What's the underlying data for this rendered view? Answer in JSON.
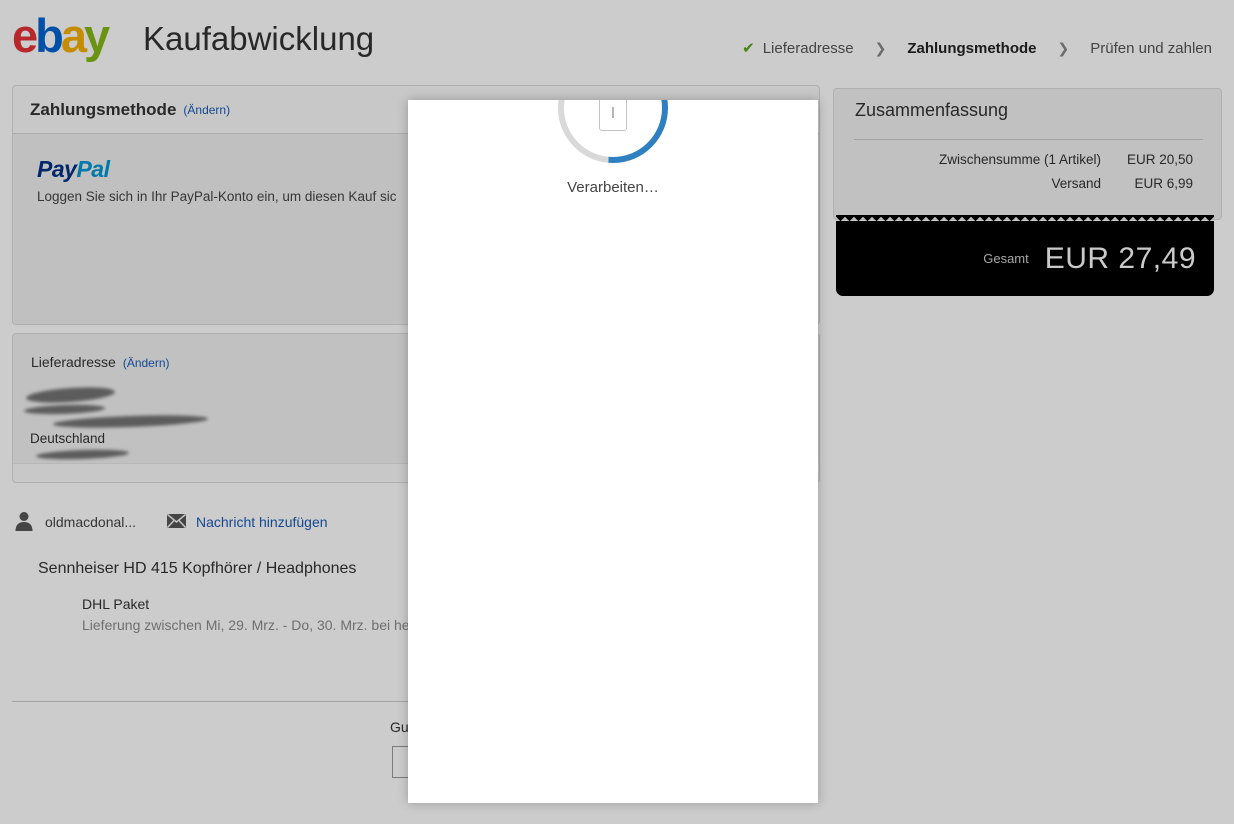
{
  "header": {
    "logo_letters": [
      "e",
      "b",
      "a",
      "y"
    ],
    "title": "Kaufabwicklung"
  },
  "breadcrumb": {
    "steps": [
      {
        "label": "Lieferadresse",
        "state": "completed"
      },
      {
        "label": "Zahlungsmethode",
        "state": "active"
      },
      {
        "label": "Prüfen und zahlen",
        "state": "upcoming"
      }
    ],
    "separator": "❯",
    "check_glyph": "✔"
  },
  "payment": {
    "title": "Zahlungsmethode",
    "change_label": "(Ändern)",
    "provider_logo": {
      "part1": "Pay",
      "part2": "Pal"
    },
    "login_text": "Loggen Sie sich in Ihr PayPal-Konto ein, um diesen Kauf sic"
  },
  "shipping_address": {
    "title": "Lieferadresse",
    "change_label": "(Ändern)",
    "country": "Deutschland",
    "redacted_lines": 4
  },
  "seller": {
    "username": "oldmacdonal...",
    "message_link": "Nachricht hinzufügen"
  },
  "item": {
    "title": "Sennheiser HD 415 Kopfhörer / Headphones",
    "shipping_method": "DHL Paket",
    "delivery_estimate": "Lieferung zwischen Mi, 29. Mrz. - Do, 30. Mrz. bei he"
  },
  "coupon": {
    "label_visible": "Gu",
    "input_value": ""
  },
  "summary": {
    "title": "Zusammenfassung",
    "rows": [
      {
        "label": "Zwischensumme (1 Artikel)",
        "value": "EUR 20,50"
      },
      {
        "label": "Versand",
        "value": "EUR 6,99"
      }
    ],
    "total_label": "Gesamt",
    "total_value": "EUR 27,49"
  },
  "processing_modal": {
    "text": "Verarbeiten…"
  },
  "colors": {
    "ebay_e": "#e53238",
    "ebay_b": "#0064d2",
    "ebay_a": "#f5af02",
    "ebay_y": "#86b817",
    "paypal_dark": "#003087",
    "paypal_light": "#0099d5",
    "link_blue": "#1b5bb5",
    "check_green": "#5aa514",
    "spinner_blue": "#2f80c1",
    "total_box_bg": "#000000"
  }
}
